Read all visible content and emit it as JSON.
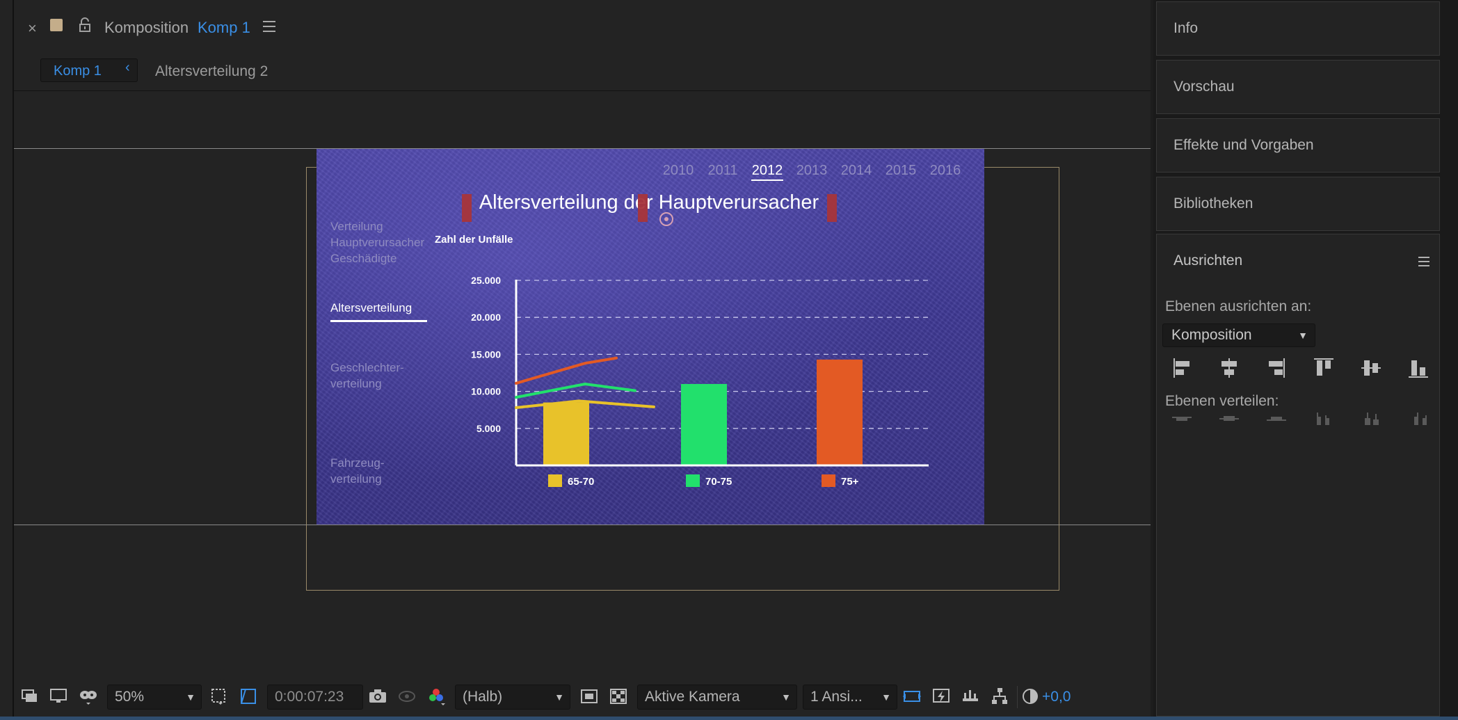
{
  "comp_panel": {
    "title_label": "Komposition",
    "comp_name": "Komp 1",
    "tabs": [
      {
        "label": "Komp 1"
      },
      {
        "label": "Altersverteilung 2"
      }
    ]
  },
  "artboard": {
    "years": [
      "2010",
      "2011",
      "2012",
      "2013",
      "2014",
      "2015",
      "2016"
    ],
    "active_year": "2012",
    "sidebar": [
      {
        "label": "Verteilung"
      },
      {
        "label": "Hauptverursacher"
      },
      {
        "label": "Geschädigte"
      },
      {
        "label": "Altersverteilung"
      },
      {
        "label": "Geschlechter-"
      },
      {
        "label": "verteilung"
      },
      {
        "label": "Fahrzeug-"
      },
      {
        "label": "verteilung"
      }
    ],
    "active_sidebar": "Altersverteilung"
  },
  "chart_data": {
    "type": "bar",
    "title": "Altersverteilung der Hauptverursacher",
    "ylabel": "Zahl der Unfälle",
    "ylim": [
      0,
      25000
    ],
    "yticks": [
      "5.000",
      "10.000",
      "15.000",
      "20.000",
      "25.000"
    ],
    "grid": true,
    "categories": [
      "65-70",
      "70-75",
      "75+"
    ],
    "values": [
      8500,
      11000,
      14300
    ],
    "colors": [
      "#e8c22a",
      "#22e06c",
      "#e35a24"
    ],
    "legend_placement": "bottom",
    "trend_lines": [
      {
        "color": "#e8c22a",
        "points": [
          [
            0,
            7800
          ],
          [
            0.5,
            8700
          ],
          [
            1.1,
            7900
          ]
        ]
      },
      {
        "color": "#22e06c",
        "points": [
          [
            0,
            9200
          ],
          [
            0.55,
            11000
          ],
          [
            0.95,
            10100
          ]
        ]
      },
      {
        "color": "#e35a24",
        "points": [
          [
            0,
            11100
          ],
          [
            0.55,
            13800
          ],
          [
            0.8,
            14500
          ]
        ]
      }
    ]
  },
  "toolbar": {
    "zoom": "50%",
    "timecode": "0:00:07:23",
    "resolution": "(Halb)",
    "camera": "Aktive Kamera",
    "views": "1 Ansi...",
    "exposure": "+0,0"
  },
  "right_panels": {
    "tabs": [
      {
        "label": "Info"
      },
      {
        "label": "Vorschau"
      },
      {
        "label": "Effekte und Vorgaben"
      },
      {
        "label": "Bibliotheken"
      }
    ],
    "align": {
      "title": "Ausrichten",
      "align_to_label": "Ebenen ausrichten an:",
      "align_to_value": "Komposition",
      "distribute_label": "Ebenen verteilen:"
    }
  },
  "colors": {
    "accent": "#3a8fe6",
    "artboard_bg": "#4038a0",
    "panel_bg": "#232323"
  }
}
